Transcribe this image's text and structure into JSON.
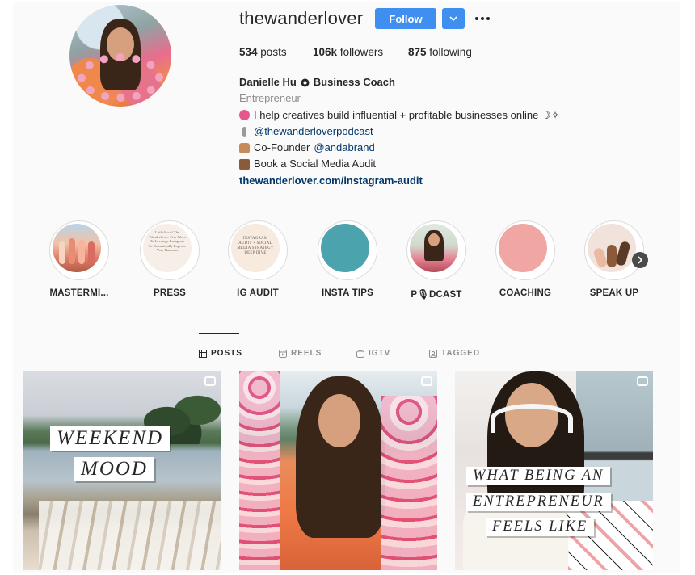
{
  "profile": {
    "username": "thewanderlover",
    "follow_label": "Follow",
    "stats": {
      "posts_count": "534",
      "posts_label": "posts",
      "followers_count": "106k",
      "followers_label": "followers",
      "following_count": "875",
      "following_label": "following"
    },
    "bio": {
      "name": "Danielle Hu",
      "title": "Business Coach",
      "category": "Entrepreneur",
      "line1": "I help creatives build influential + profitable businesses online ☽✧",
      "podcast_link": "@thewanderloverpodcast",
      "cofounder_prefix": "Co-Founder",
      "cofounder_link": "@andabrand",
      "audit_line": "Book a Social Media Audit",
      "website": "thewanderlover.com/instagram-audit"
    }
  },
  "highlights": [
    {
      "label": "MASTERMI...",
      "color": "#e9a08c"
    },
    {
      "label": "PRESS",
      "color": "#f5efe8",
      "preview_text": "Little Hu of The Wanderlover: Five Ways To Leverage Instagram To Dramatically Improve Your Business"
    },
    {
      "label": "IG AUDIT",
      "color": "#f7eadf",
      "preview_text": "INSTAGRAM AUDIT + SOCIAL MEDIA STRATEGY DEEP DIVE"
    },
    {
      "label": "INSTA TIPS",
      "color": "#4aa3ad"
    },
    {
      "label": "P🎙DCAST",
      "color": "#c9d6c8"
    },
    {
      "label": "COACHING",
      "color": "#f0a7a3"
    },
    {
      "label": "SPEAK UP",
      "color": "#f1e2dc"
    }
  ],
  "tabs": [
    {
      "label": "POSTS",
      "icon": "grid-icon",
      "active": true
    },
    {
      "label": "REELS",
      "icon": "reels-icon",
      "active": false
    },
    {
      "label": "IGTV",
      "icon": "igtv-icon",
      "active": false
    },
    {
      "label": "TAGGED",
      "icon": "tag-icon",
      "active": false
    }
  ],
  "posts": [
    {
      "caption_lines": [
        "WEEKEND",
        "MOOD"
      ],
      "type_icon": "reel-icon"
    },
    {
      "caption_lines": [],
      "type_icon": "carousel-icon"
    },
    {
      "caption_lines": [
        "WHAT BEING AN",
        "ENTREPRENEUR",
        "FEELS LIKE"
      ],
      "type_icon": "reel-icon"
    }
  ],
  "colors": {
    "accent": "#3e8ff0",
    "link": "#00376b",
    "muted": "#8e8e8e"
  }
}
